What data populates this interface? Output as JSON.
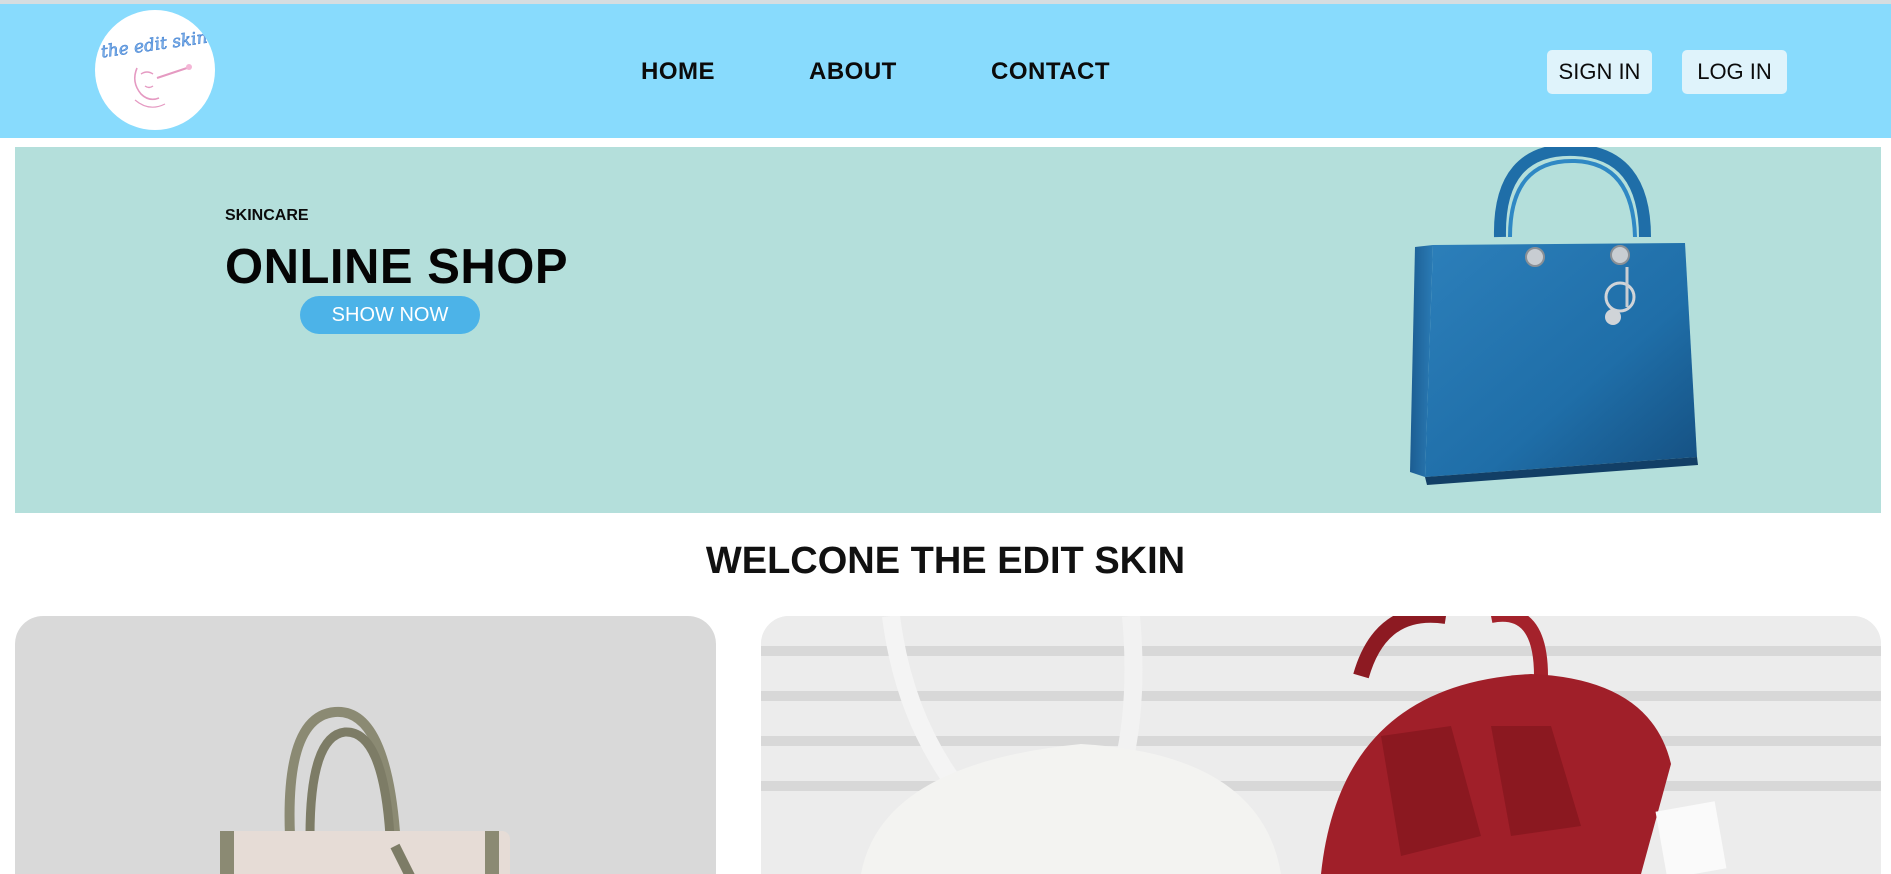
{
  "brand": {
    "logo_text": "the edit skin"
  },
  "nav": {
    "items": [
      "HOME",
      "ABOUT",
      "CONTACT"
    ]
  },
  "auth": {
    "sign_in": "SIGN IN",
    "log_in": "LOG IN"
  },
  "hero": {
    "kicker": "SKINCARE",
    "title": "ONLINE SHOP",
    "button": "SHOW NOW"
  },
  "welcome": {
    "title": "WELCONE THE EDIT SKIN"
  },
  "colors": {
    "header_bg": "#88dbfd",
    "hero_bg": "#b4dfdb",
    "accent_button": "#4cb3e8",
    "auth_button_bg": "#dff3fb"
  }
}
